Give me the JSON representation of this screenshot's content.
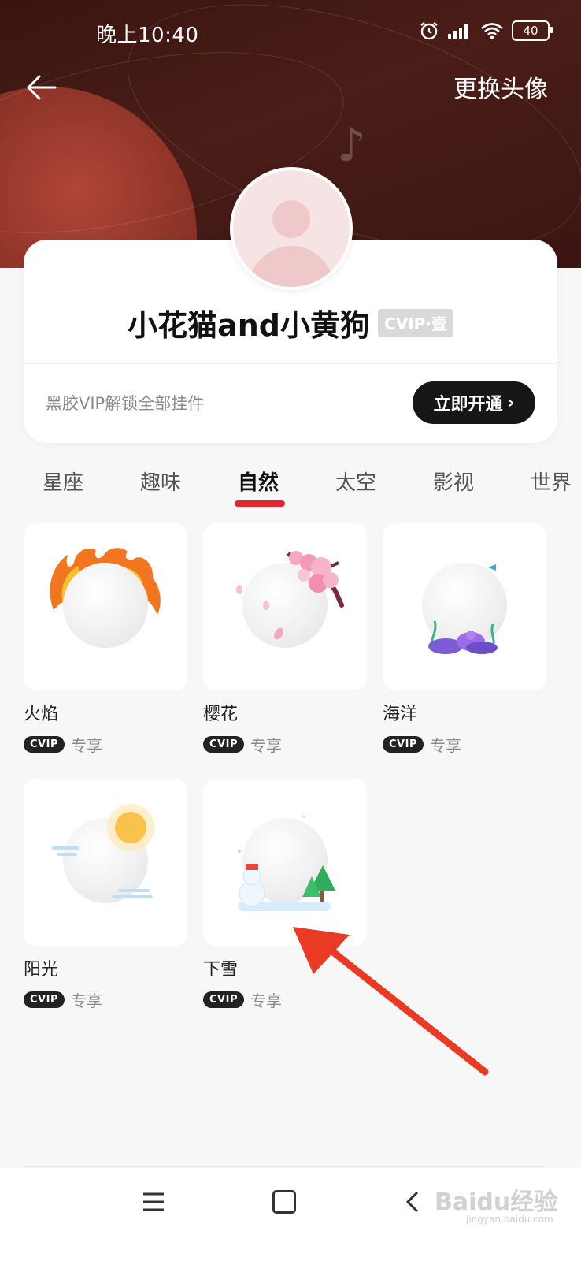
{
  "status_bar": {
    "time": "晚上10:40",
    "battery": "40",
    "icons": [
      "alarm-icon",
      "signal-icon",
      "wifi-icon",
      "battery-icon"
    ]
  },
  "header": {
    "back_icon": "back-arrow-icon",
    "action_label": "更换头像"
  },
  "profile": {
    "username": "小花猫and小黄狗",
    "vip_level": "CVIP·壹",
    "promo_text": "黑胶VIP解锁全部挂件",
    "open_button": "立即开通",
    "open_button_arrow": "›"
  },
  "tabs": [
    {
      "label": "星座",
      "active": false
    },
    {
      "label": "趣味",
      "active": false
    },
    {
      "label": "自然",
      "active": true
    },
    {
      "label": "太空",
      "active": false
    },
    {
      "label": "影视",
      "active": false
    },
    {
      "label": "世界",
      "active": false
    }
  ],
  "pendants": [
    {
      "name": "火焰",
      "badge": "CVIP",
      "badge_text": "专享",
      "decoration": "flame"
    },
    {
      "name": "樱花",
      "badge": "CVIP",
      "badge_text": "专享",
      "decoration": "cherry-blossom"
    },
    {
      "name": "海洋",
      "badge": "CVIP",
      "badge_text": "专享",
      "decoration": "ocean"
    },
    {
      "name": "阳光",
      "badge": "CVIP",
      "badge_text": "专享",
      "decoration": "sun"
    },
    {
      "name": "下雪",
      "badge": "CVIP",
      "badge_text": "专享",
      "decoration": "snow"
    }
  ],
  "annotation": {
    "arrow_color": "#ea3a24"
  },
  "nav_bar": {
    "icons": [
      "menu-icon",
      "home-icon",
      "back-icon"
    ]
  },
  "watermark": {
    "brand": "Baidu经验",
    "url": "jingyan.baidu.com"
  },
  "colors": {
    "accent": "#e3272e",
    "button_dark": "#161616",
    "header_bg": "#3a1410"
  }
}
